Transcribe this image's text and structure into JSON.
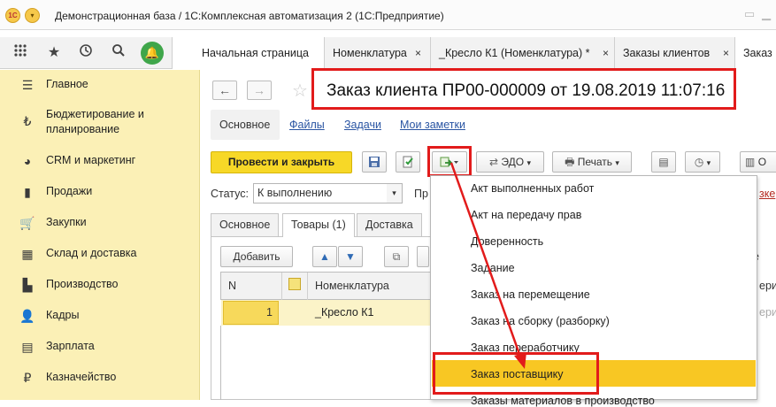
{
  "window": {
    "title": "Демонстрационная база / 1С:Комплексная автоматизация 2 (1С:Предприятие)",
    "logo_text": "1С"
  },
  "tabs": [
    {
      "label": "Начальная страница"
    },
    {
      "label": "Номенклатура",
      "close": "×"
    },
    {
      "label": "_Кресло К1 (Номенклатура) *",
      "close": "×"
    },
    {
      "label": "Заказы клиентов",
      "close": "×"
    },
    {
      "label": "Заказ"
    }
  ],
  "sidebar": {
    "items": [
      {
        "label": "Главное",
        "icon": "menu-lines-icon"
      },
      {
        "label": "Бюджетирование и",
        "label2": "планирование",
        "icon": "budget-icon"
      },
      {
        "label": "CRM и маркетинг",
        "icon": "pie-chart-icon"
      },
      {
        "label": "Продажи",
        "icon": "shopping-bag-icon"
      },
      {
        "label": "Закупки",
        "icon": "cart-icon"
      },
      {
        "label": "Склад и доставка",
        "icon": "warehouse-grid-icon"
      },
      {
        "label": "Производство",
        "icon": "factory-icon"
      },
      {
        "label": "Кадры",
        "icon": "people-icon"
      },
      {
        "label": "Зарплата",
        "icon": "payroll-icon"
      },
      {
        "label": "Казначейство",
        "icon": "ruble-icon"
      }
    ]
  },
  "document": {
    "title": "Заказ клиента ПР00-000009 от 19.08.2019 11:07:16"
  },
  "form_tabs": [
    "Основное",
    "Файлы",
    "Задачи",
    "Мои заметки"
  ],
  "toolbar": {
    "post_close": "Провести и закрыть",
    "edo": "ЭДО",
    "print": "Печать",
    "partial_o": "О"
  },
  "status": {
    "label": "Статус:",
    "value": "К выполнению",
    "partial_right": "Пр",
    "far_right": "зке"
  },
  "inner_tabs": [
    "Основное",
    "Товары (1)",
    "Доставка"
  ],
  "items_toolbar": {
    "add": "Добавить",
    "partial_right": "е"
  },
  "grid": {
    "columns": [
      "N",
      "Номенклатура"
    ],
    "far_right_col": "ерия",
    "rows": [
      {
        "n": "1",
        "name": "_Кресло К1",
        "far_right": "ерия"
      }
    ]
  },
  "dropdown": {
    "items": [
      "Акт выполненных работ",
      "Акт на передачу прав",
      "Доверенность",
      "Задание",
      "Заказ на перемещение",
      "Заказ на сборку (разборку)",
      "Заказ переработчику",
      "Заказ поставщику",
      "Заказы материалов в производство"
    ],
    "highlighted_index": 7
  },
  "colors": {
    "sidebar_bg": "#fbf0b6",
    "accent_yellow": "#f7d827",
    "highlight": "#f8c723",
    "annotation_red": "#e21b1b",
    "link_blue": "#2a55a3"
  }
}
